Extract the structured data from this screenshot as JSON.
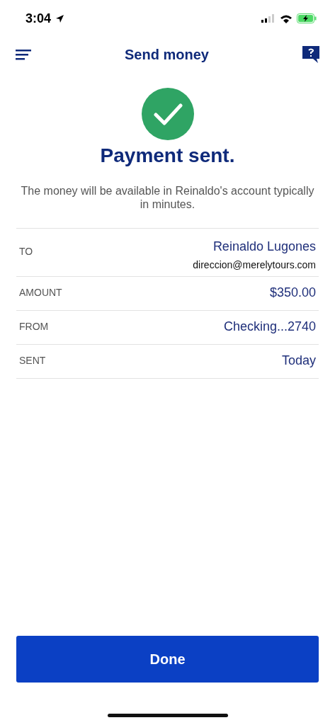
{
  "status_bar": {
    "time": "3:04"
  },
  "header": {
    "title": "Send money"
  },
  "result": {
    "title": "Payment sent.",
    "message": "The money will be available in Reinaldo's account typically in minutes."
  },
  "details": [
    {
      "label": "TO",
      "value": "Reinaldo Lugones",
      "subvalue": "direccion@merelytours.com"
    },
    {
      "label": "AMOUNT",
      "value": "$350.00"
    },
    {
      "label": "FROM",
      "value": "Checking...2740"
    },
    {
      "label": "SENT",
      "value": "Today"
    }
  ],
  "buttons": [
    {
      "label": "Done"
    }
  ]
}
